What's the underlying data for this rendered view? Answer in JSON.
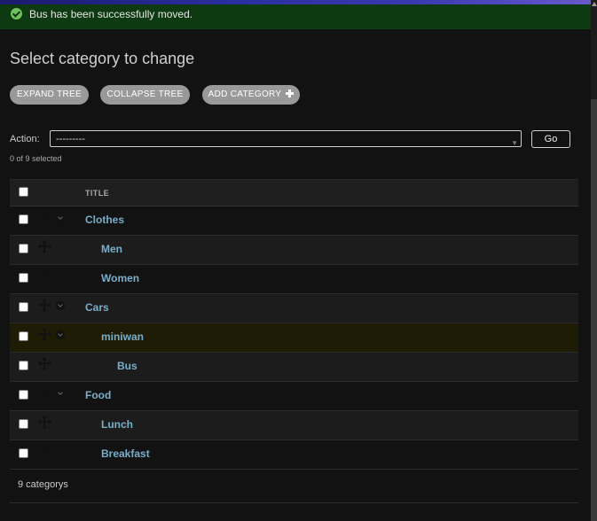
{
  "message": {
    "text": "Bus has been successfully moved.",
    "icon": "check-circle-icon",
    "color": "#72c05b"
  },
  "page_title": "Select category to change",
  "tools": {
    "expand_label": "EXPAND TREE",
    "collapse_label": "COLLAPSE TREE",
    "add_label": "ADD CATEGORY"
  },
  "actions": {
    "label": "Action:",
    "selected": "---------",
    "go_label": "Go",
    "counter": "0 of 9 selected"
  },
  "table": {
    "header_title": "TITLE",
    "rows": [
      {
        "title": "Clothes",
        "level": 0,
        "has_children": true
      },
      {
        "title": "Men",
        "level": 1,
        "has_children": false
      },
      {
        "title": "Women",
        "level": 1,
        "has_children": false
      },
      {
        "title": "Cars",
        "level": 0,
        "has_children": true
      },
      {
        "title": "miniwan",
        "level": 1,
        "has_children": true,
        "highlighted": true
      },
      {
        "title": "Bus",
        "level": 2,
        "has_children": false
      },
      {
        "title": "Food",
        "level": 0,
        "has_children": true
      },
      {
        "title": "Lunch",
        "level": 1,
        "has_children": false
      },
      {
        "title": "Breakfast",
        "level": 1,
        "has_children": false
      }
    ]
  },
  "footer": {
    "count_text": "9 categorys"
  },
  "colors": {
    "link": "#79aec8",
    "success_bg": "#0e3a12",
    "button_bg": "#999999",
    "highlight_row": "#1f1c06"
  }
}
